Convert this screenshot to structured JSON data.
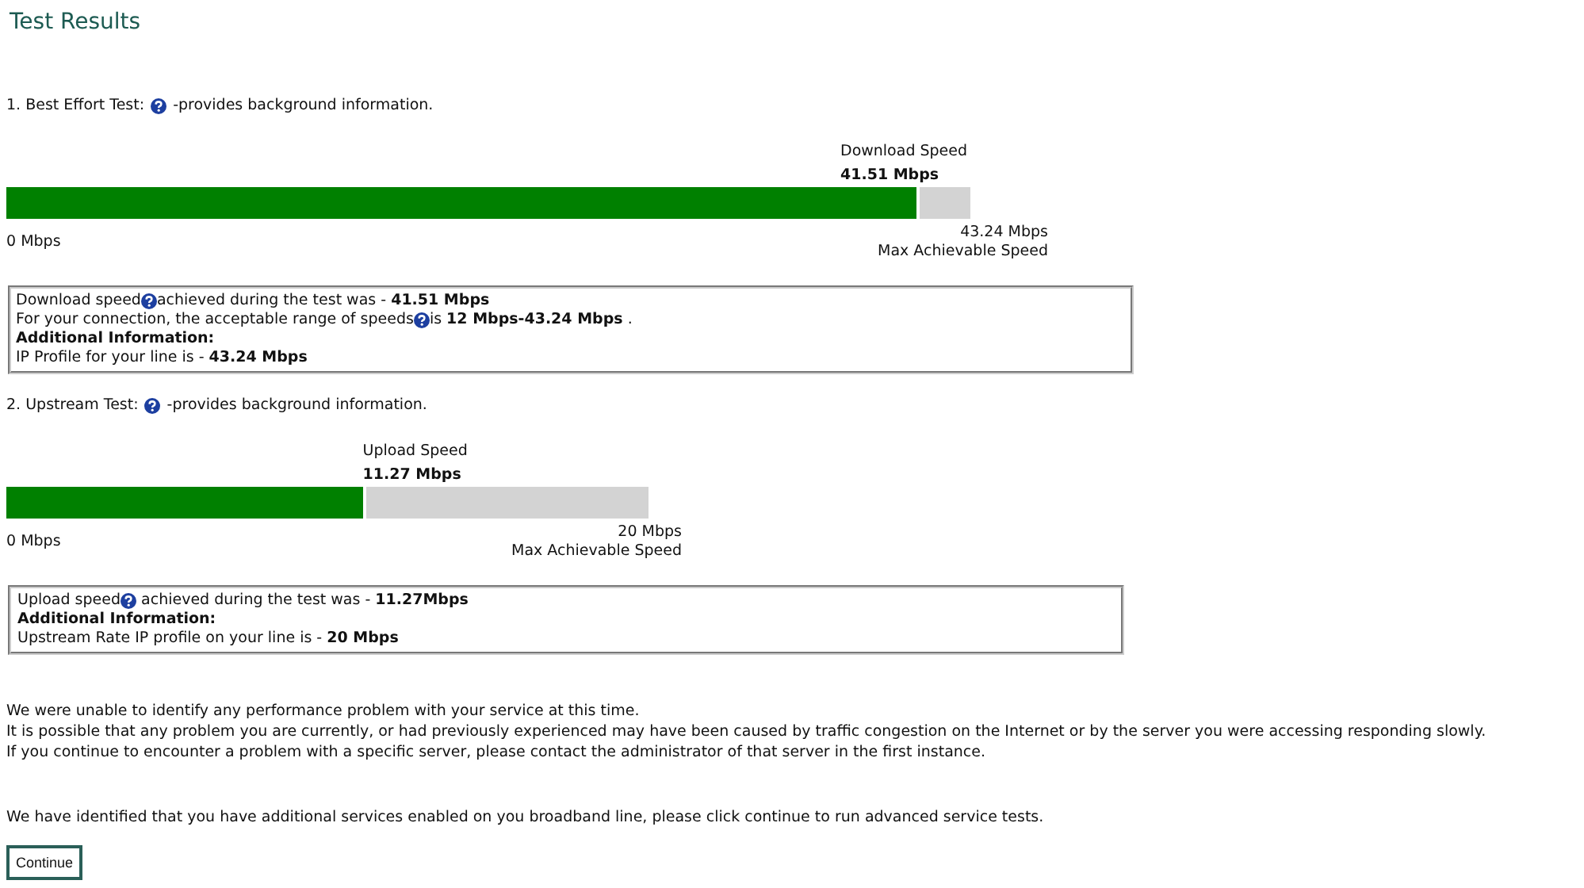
{
  "title": "Test Results",
  "tests": [
    {
      "label": "1. Best Effort Test:",
      "description": "-provides background information.",
      "speed_label": "Download Speed",
      "speed_value": "41.51 Mbps",
      "level": 0.947,
      "min_label": "0 Mbps",
      "max_value": "43.24 Mbps",
      "max_label": "Max Achievable Speed",
      "info": [
        {
          "kind": "text",
          "parts": [
            "Download speed",
            "achieved during the test was - **41.51 Mbps**"
          ]
        },
        {
          "kind": "text",
          "parts": [
            "For your connection, the acceptable range of speeds",
            "is **12 Mbps-43.24 Mbps** ."
          ]
        },
        {
          "kind": "heading",
          "parts": [
            "Additional Information:"
          ]
        },
        {
          "kind": "text",
          "parts": [
            "IP Profile for your line is - **43.24 Mbps**"
          ]
        }
      ]
    },
    {
      "label": "2. Upstream Test:",
      "description": "-provides background information.",
      "speed_label": "Upload Speed",
      "speed_value": "11.27 Mbps",
      "level": 0.56,
      "min_label": "0 Mbps",
      "max_value": "20 Mbps",
      "max_label": "Max Achievable Speed",
      "info": [
        {
          "kind": "text",
          "parts": [
            "Upload speed",
            " achieved during the test was - **11.27Mbps**"
          ]
        },
        {
          "kind": "heading",
          "parts": [
            "Additional Information:"
          ]
        },
        {
          "kind": "text",
          "parts": [
            "Upstream Rate IP profile on your line is - **20 Mbps**"
          ]
        }
      ]
    }
  ],
  "summary": [
    "We were unable to identify any performance problem with your service at this time.",
    "It is possible that any problem you are currently, or had previously experienced may have been caused by traffic congestion on the Internet or by the server you were accessing responding slowly.",
    "If you continue to encounter a problem with a specific server, please contact the administrator of that server in the first instance."
  ],
  "notice": "We have identified that you have additional services enabled on you broadband line, please click continue to run advanced service tests.",
  "button": "Continue"
}
